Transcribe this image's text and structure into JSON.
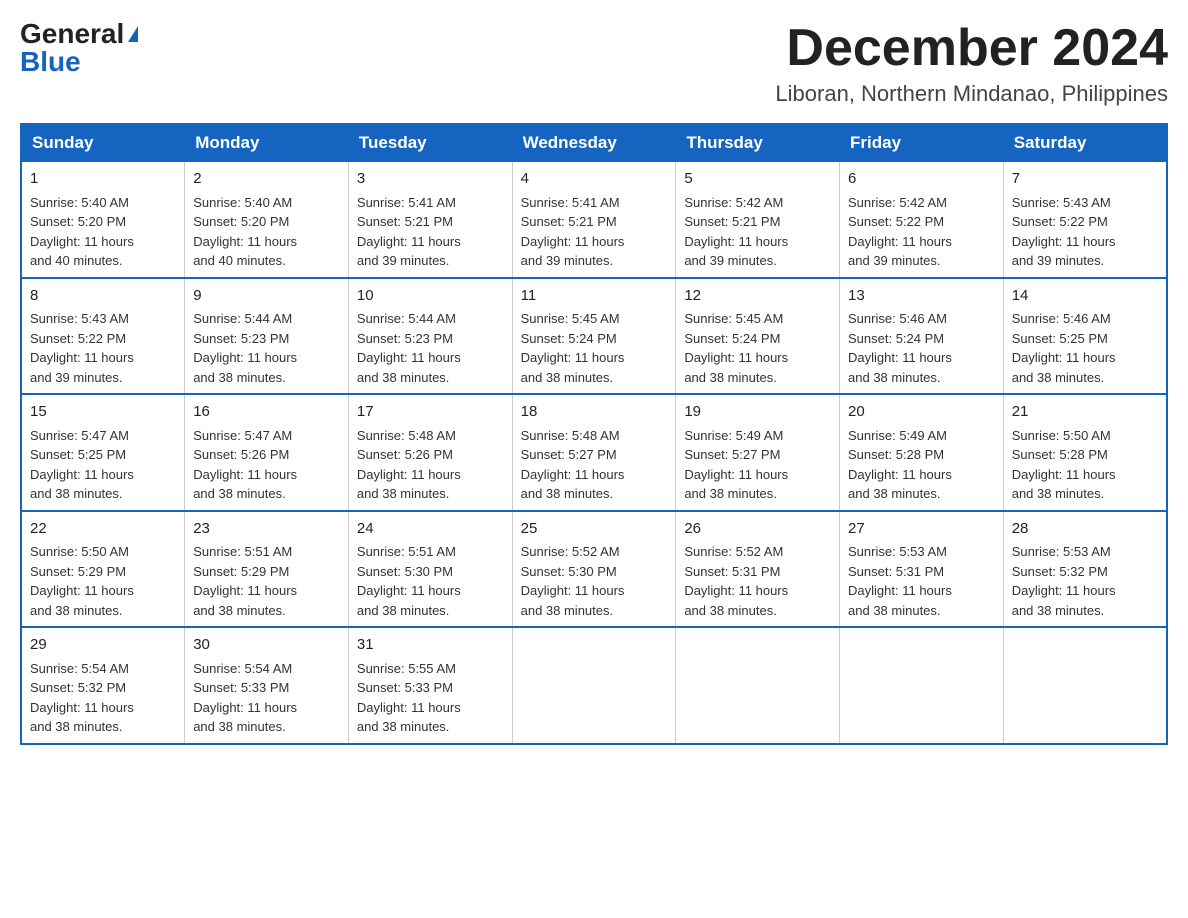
{
  "header": {
    "logo_general": "General",
    "logo_blue": "Blue",
    "month_title": "December 2024",
    "location": "Liboran, Northern Mindanao, Philippines"
  },
  "days_of_week": [
    "Sunday",
    "Monday",
    "Tuesday",
    "Wednesday",
    "Thursday",
    "Friday",
    "Saturday"
  ],
  "weeks": [
    [
      {
        "day": "1",
        "sunrise": "5:40 AM",
        "sunset": "5:20 PM",
        "daylight": "11 hours and 40 minutes."
      },
      {
        "day": "2",
        "sunrise": "5:40 AM",
        "sunset": "5:20 PM",
        "daylight": "11 hours and 40 minutes."
      },
      {
        "day": "3",
        "sunrise": "5:41 AM",
        "sunset": "5:21 PM",
        "daylight": "11 hours and 39 minutes."
      },
      {
        "day": "4",
        "sunrise": "5:41 AM",
        "sunset": "5:21 PM",
        "daylight": "11 hours and 39 minutes."
      },
      {
        "day": "5",
        "sunrise": "5:42 AM",
        "sunset": "5:21 PM",
        "daylight": "11 hours and 39 minutes."
      },
      {
        "day": "6",
        "sunrise": "5:42 AM",
        "sunset": "5:22 PM",
        "daylight": "11 hours and 39 minutes."
      },
      {
        "day": "7",
        "sunrise": "5:43 AM",
        "sunset": "5:22 PM",
        "daylight": "11 hours and 39 minutes."
      }
    ],
    [
      {
        "day": "8",
        "sunrise": "5:43 AM",
        "sunset": "5:22 PM",
        "daylight": "11 hours and 39 minutes."
      },
      {
        "day": "9",
        "sunrise": "5:44 AM",
        "sunset": "5:23 PM",
        "daylight": "11 hours and 38 minutes."
      },
      {
        "day": "10",
        "sunrise": "5:44 AM",
        "sunset": "5:23 PM",
        "daylight": "11 hours and 38 minutes."
      },
      {
        "day": "11",
        "sunrise": "5:45 AM",
        "sunset": "5:24 PM",
        "daylight": "11 hours and 38 minutes."
      },
      {
        "day": "12",
        "sunrise": "5:45 AM",
        "sunset": "5:24 PM",
        "daylight": "11 hours and 38 minutes."
      },
      {
        "day": "13",
        "sunrise": "5:46 AM",
        "sunset": "5:24 PM",
        "daylight": "11 hours and 38 minutes."
      },
      {
        "day": "14",
        "sunrise": "5:46 AM",
        "sunset": "5:25 PM",
        "daylight": "11 hours and 38 minutes."
      }
    ],
    [
      {
        "day": "15",
        "sunrise": "5:47 AM",
        "sunset": "5:25 PM",
        "daylight": "11 hours and 38 minutes."
      },
      {
        "day": "16",
        "sunrise": "5:47 AM",
        "sunset": "5:26 PM",
        "daylight": "11 hours and 38 minutes."
      },
      {
        "day": "17",
        "sunrise": "5:48 AM",
        "sunset": "5:26 PM",
        "daylight": "11 hours and 38 minutes."
      },
      {
        "day": "18",
        "sunrise": "5:48 AM",
        "sunset": "5:27 PM",
        "daylight": "11 hours and 38 minutes."
      },
      {
        "day": "19",
        "sunrise": "5:49 AM",
        "sunset": "5:27 PM",
        "daylight": "11 hours and 38 minutes."
      },
      {
        "day": "20",
        "sunrise": "5:49 AM",
        "sunset": "5:28 PM",
        "daylight": "11 hours and 38 minutes."
      },
      {
        "day": "21",
        "sunrise": "5:50 AM",
        "sunset": "5:28 PM",
        "daylight": "11 hours and 38 minutes."
      }
    ],
    [
      {
        "day": "22",
        "sunrise": "5:50 AM",
        "sunset": "5:29 PM",
        "daylight": "11 hours and 38 minutes."
      },
      {
        "day": "23",
        "sunrise": "5:51 AM",
        "sunset": "5:29 PM",
        "daylight": "11 hours and 38 minutes."
      },
      {
        "day": "24",
        "sunrise": "5:51 AM",
        "sunset": "5:30 PM",
        "daylight": "11 hours and 38 minutes."
      },
      {
        "day": "25",
        "sunrise": "5:52 AM",
        "sunset": "5:30 PM",
        "daylight": "11 hours and 38 minutes."
      },
      {
        "day": "26",
        "sunrise": "5:52 AM",
        "sunset": "5:31 PM",
        "daylight": "11 hours and 38 minutes."
      },
      {
        "day": "27",
        "sunrise": "5:53 AM",
        "sunset": "5:31 PM",
        "daylight": "11 hours and 38 minutes."
      },
      {
        "day": "28",
        "sunrise": "5:53 AM",
        "sunset": "5:32 PM",
        "daylight": "11 hours and 38 minutes."
      }
    ],
    [
      {
        "day": "29",
        "sunrise": "5:54 AM",
        "sunset": "5:32 PM",
        "daylight": "11 hours and 38 minutes."
      },
      {
        "day": "30",
        "sunrise": "5:54 AM",
        "sunset": "5:33 PM",
        "daylight": "11 hours and 38 minutes."
      },
      {
        "day": "31",
        "sunrise": "5:55 AM",
        "sunset": "5:33 PM",
        "daylight": "11 hours and 38 minutes."
      },
      null,
      null,
      null,
      null
    ]
  ],
  "labels": {
    "sunrise": "Sunrise:",
    "sunset": "Sunset:",
    "daylight": "Daylight:"
  }
}
